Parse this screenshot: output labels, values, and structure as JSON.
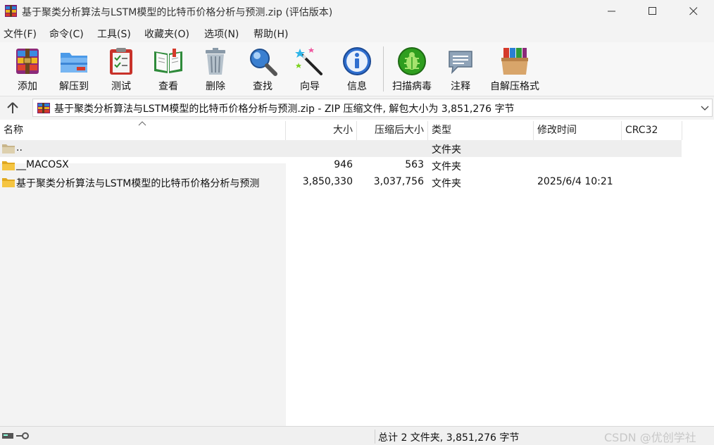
{
  "window": {
    "title": "基于聚类分析算法与LSTM模型的比特币价格分析与预测.zip (评估版本)"
  },
  "menu": [
    "文件(F)",
    "命令(C)",
    "工具(S)",
    "收藏夹(O)",
    "选项(N)",
    "帮助(H)"
  ],
  "toolbar": {
    "add": "添加",
    "extract": "解压到",
    "test": "测试",
    "view": "查看",
    "delete": "删除",
    "find": "查找",
    "wizard": "向导",
    "info": "信息",
    "virusscan": "扫描病毒",
    "comment": "注释",
    "sfx": "自解压格式"
  },
  "address": {
    "text": "基于聚类分析算法与LSTM模型的比特币价格分析与预测.zip - ZIP 压缩文件, 解包大小为 3,851,276 字节"
  },
  "columns": {
    "name": "名称",
    "size": "大小",
    "packed": "压缩后大小",
    "type": "类型",
    "modified": "修改时间",
    "crc": "CRC32"
  },
  "rows": [
    {
      "name": "..",
      "size": "",
      "packed": "",
      "type": "文件夹",
      "modified": ""
    },
    {
      "name": "__MACOSX",
      "size": "946",
      "packed": "563",
      "type": "文件夹",
      "modified": ""
    },
    {
      "name": "基于聚类分析算法与LSTM模型的比特币价格分析与预测",
      "size": "3,850,330",
      "packed": "3,037,756",
      "type": "文件夹",
      "modified": "2025/6/4 10:21"
    }
  ],
  "status": {
    "summary": "总计 2 文件夹, 3,851,276 字节",
    "watermark": "CSDN @优创学社"
  },
  "icons": {
    "app": "winrar-icon",
    "up": "up-arrow-icon"
  },
  "colors": {
    "folder": "#f5c542",
    "virus_green": "#2f9e1f"
  }
}
